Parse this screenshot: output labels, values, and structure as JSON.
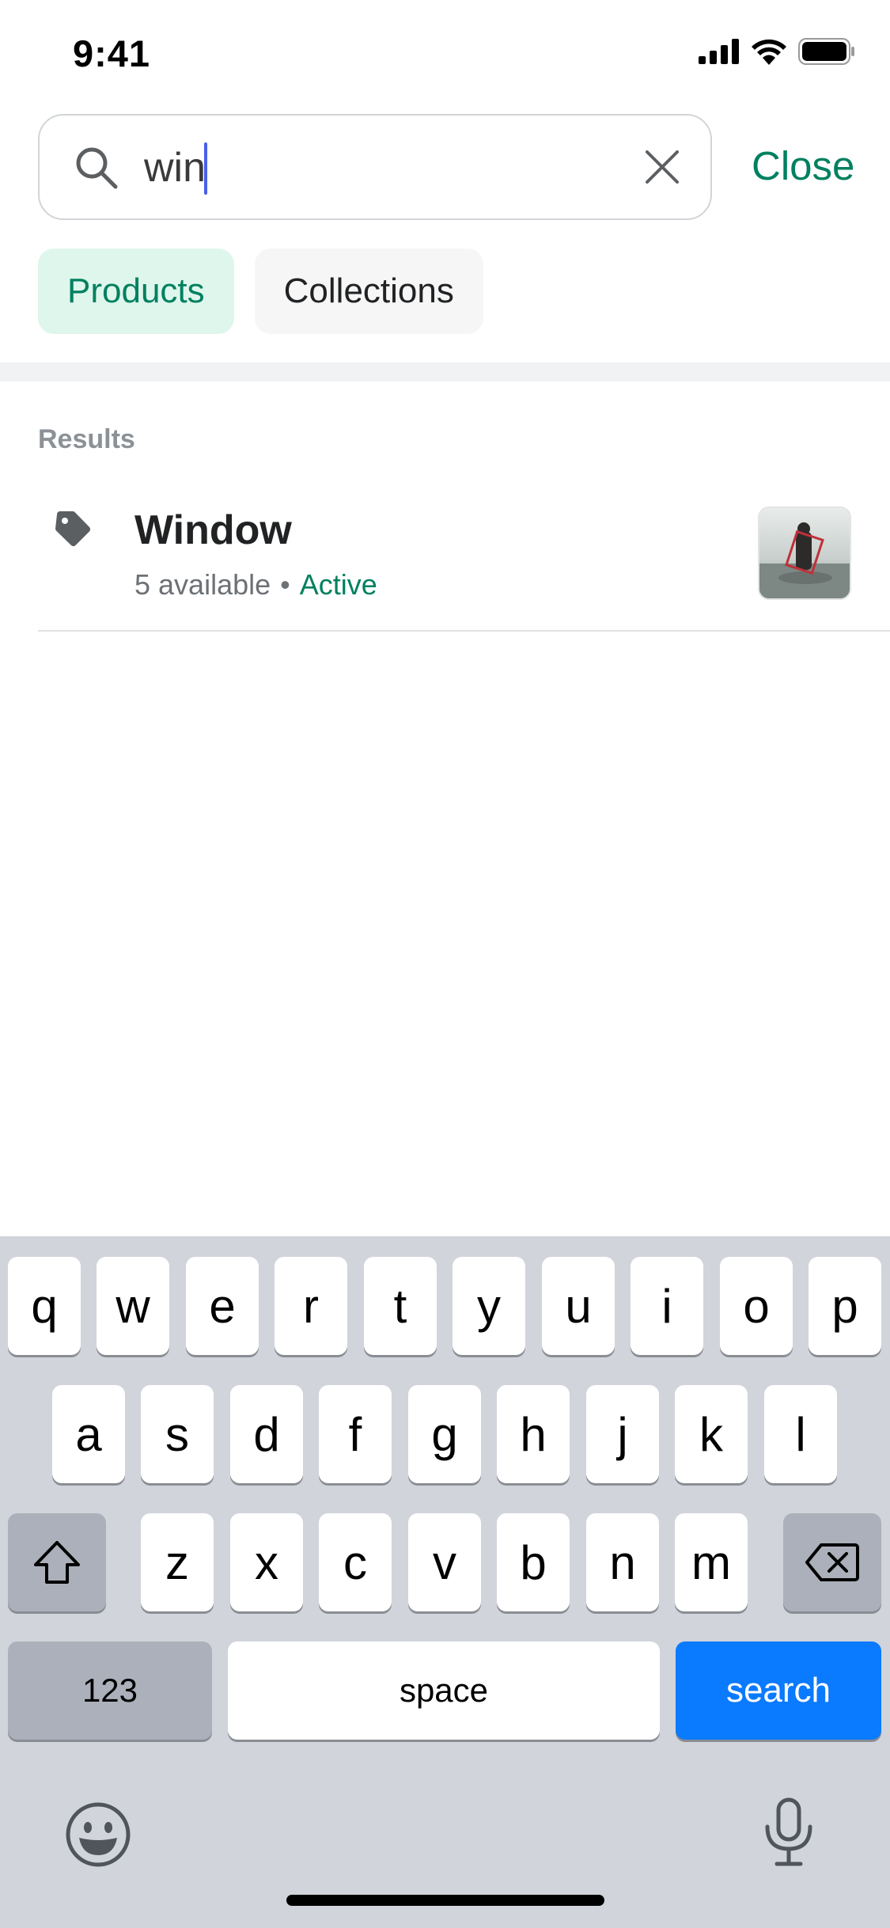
{
  "status_bar": {
    "time": "9:41",
    "icons": [
      "cellular-signal-icon",
      "wifi-icon",
      "battery-icon"
    ]
  },
  "search": {
    "value": "win",
    "placeholder": "",
    "close_label": "Close"
  },
  "filters": [
    {
      "label": "Products",
      "active": true
    },
    {
      "label": "Collections",
      "active": false
    }
  ],
  "results_section": {
    "label": "Results",
    "items": [
      {
        "title": "Window",
        "availability": "5 available",
        "separator": "•",
        "status": "Active",
        "icon": "tag-icon"
      }
    ]
  },
  "keyboard": {
    "row1": [
      "q",
      "w",
      "e",
      "r",
      "t",
      "y",
      "u",
      "i",
      "o",
      "p"
    ],
    "row2": [
      "a",
      "s",
      "d",
      "f",
      "g",
      "h",
      "j",
      "k",
      "l"
    ],
    "row3": [
      "z",
      "x",
      "c",
      "v",
      "b",
      "n",
      "m"
    ],
    "numbers_label": "123",
    "space_label": "space",
    "search_label": "search"
  },
  "colors": {
    "accent": "#008060",
    "chip_active_bg": "#dff6ec",
    "keyboard_bg": "#d1d4db",
    "search_key": "#0a7aff"
  }
}
